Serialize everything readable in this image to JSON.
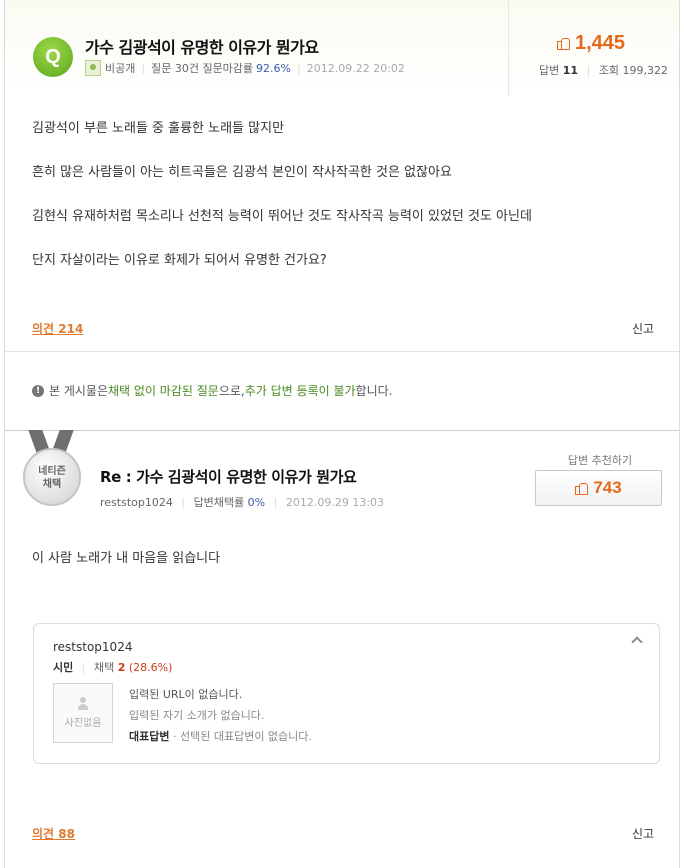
{
  "question": {
    "badge": "Q",
    "title": "가수 김광석이 유명한 이유가 뭔가요",
    "author": "비공개",
    "stats_label": "질문 30건 질문마감률",
    "close_rate": "92.6%",
    "date": "2012.09.22 20:02",
    "score": "1,445",
    "answers_label": "답변",
    "answers_count": "11",
    "views_label": "조회",
    "views_count": "199,322",
    "body": [
      "김광석이 부른 노래들 중 훌륭한 노래들 많지만",
      "흔히 많은 사람들이 아는 히트곡들은 김광석 본인이 작사작곡한 것은 없잖아요",
      "김현식 유재하처럼 목소리나 선천적 능력이 뛰어난 것도 작사작곡 능력이 있었던 것도 아닌데",
      "단지 자살이라는 이유로 화제가 되어서 유명한 건가요?"
    ],
    "opinion_link": "의견 214",
    "report_label": "신고"
  },
  "notice": {
    "icon": "!",
    "prefix": "본 게시물은 ",
    "green1": "채택 없이 마감된 질문",
    "middle": "으로, ",
    "green2": "추가 답변 등록이 불가",
    "suffix": "합니다."
  },
  "answer": {
    "medal_line1": "네티즌",
    "medal_line2": "채택",
    "title": "Re : 가수 김광석이 유명한 이유가 뭔가요",
    "author": "reststop1024",
    "adopt_label": "답변채택률",
    "adopt_rate": "0%",
    "date": "2012.09.29 13:03",
    "recommend_label": "답변 추천하기",
    "recommend_count": "743",
    "body": "이 사람 노래가 내 마음을 읽습니다",
    "opinion_link": "의견 88",
    "report_label": "신고"
  },
  "profile": {
    "name": "reststop1024",
    "rank": "시민",
    "adopt_label": "채택",
    "adopt_count": "2",
    "adopt_rate": "(28.6%)",
    "photo_text": "사진없음",
    "url_text": "입력된 URL이 없습니다.",
    "intro_text": "입력된 자기 소개가 없습니다.",
    "rep_label": "대표답변",
    "rep_text": "· 선택된 대표답변이 없습니다."
  },
  "colors": {
    "accent_orange": "#e5691c",
    "badge_green": "#5aa41b",
    "notice_green": "#4a8a1e",
    "rate_blue": "#3a5da8"
  }
}
